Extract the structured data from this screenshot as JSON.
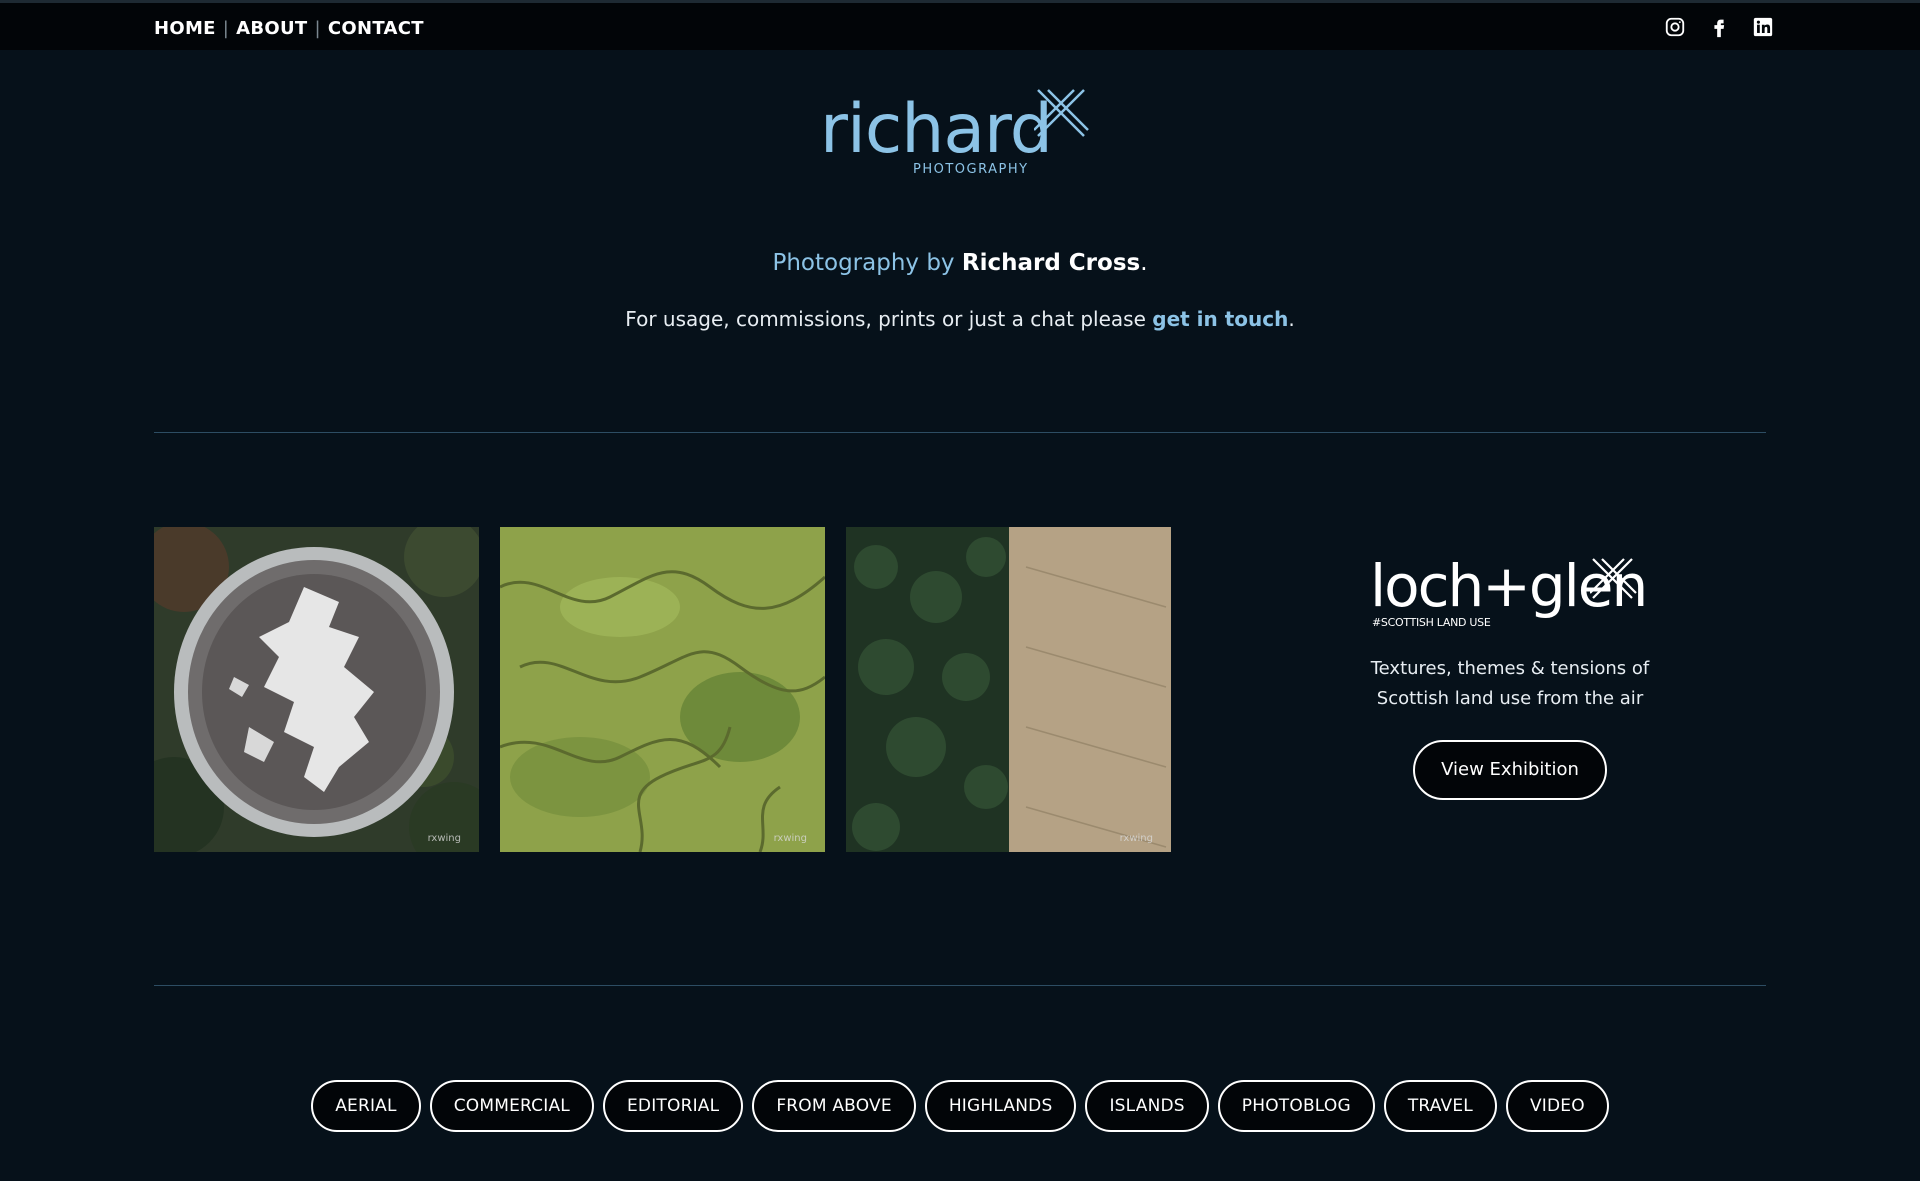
{
  "nav": {
    "items": [
      "HOME",
      "ABOUT",
      "CONTACT"
    ],
    "separator": "|"
  },
  "social": [
    "instagram-icon",
    "facebook-icon",
    "linkedin-icon"
  ],
  "logo": {
    "word": "richard",
    "sub": "PHOTOGRAPHY"
  },
  "tagline": {
    "prefix": "Photography by ",
    "name": "Richard Cross",
    "suffix": "."
  },
  "usage": {
    "text": "For usage, commissions, prints or just a chat please ",
    "link": "get in touch",
    "suffix": "."
  },
  "photos": [
    {
      "watermark": "rxwing"
    },
    {
      "watermark": "rxwing"
    },
    {
      "watermark": "rxwing"
    }
  ],
  "exhibition": {
    "logo_word": "loch+glen",
    "logo_sub": "#SCOTTISH LAND USE",
    "description_line1": "Textures, themes & tensions of",
    "description_line2": "Scottish land use from the air",
    "button": "View Exhibition"
  },
  "categories": [
    "AERIAL",
    "COMMERCIAL",
    "EDITORIAL",
    "FROM ABOVE",
    "HIGHLANDS",
    "ISLANDS",
    "PHOTOBLOG",
    "TRAVEL",
    "VIDEO"
  ],
  "colors": {
    "background": "#06111a",
    "accent": "#8cc3e6",
    "topbar": "#020508",
    "rule": "#2d4d63"
  }
}
